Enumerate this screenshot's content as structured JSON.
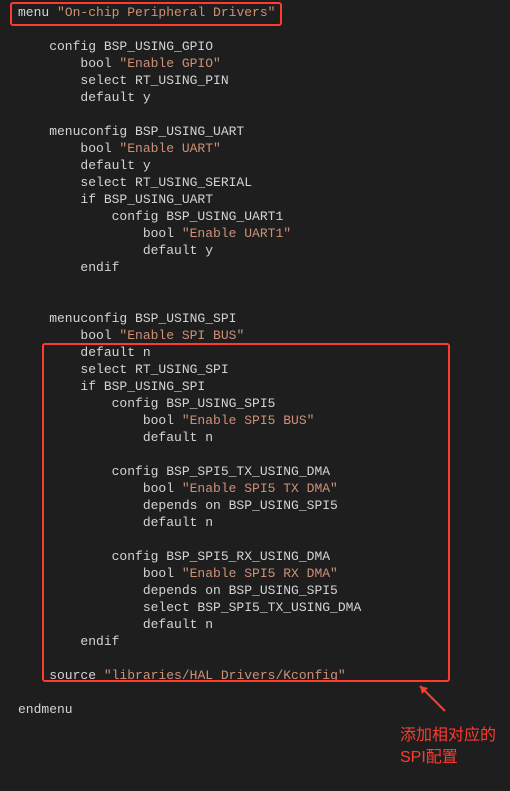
{
  "lines": [
    {
      "indent": 0,
      "t": "menu ",
      "s": "\"On-chip Peripheral Drivers\""
    },
    {
      "blank": true
    },
    {
      "indent": 1,
      "t": "config BSP_USING_GPIO"
    },
    {
      "indent": 2,
      "t": "bool ",
      "s": "\"Enable GPIO\""
    },
    {
      "indent": 2,
      "t": "select RT_USING_PIN"
    },
    {
      "indent": 2,
      "t": "default y"
    },
    {
      "blank": true
    },
    {
      "indent": 1,
      "t": "menuconfig BSP_USING_UART"
    },
    {
      "indent": 2,
      "t": "bool ",
      "s": "\"Enable UART\""
    },
    {
      "indent": 2,
      "t": "default y"
    },
    {
      "indent": 2,
      "t": "select RT_USING_SERIAL"
    },
    {
      "indent": 2,
      "t": "if BSP_USING_UART"
    },
    {
      "indent": 3,
      "t": "config BSP_USING_UART1"
    },
    {
      "indent": 4,
      "t": "bool ",
      "s": "\"Enable UART1\""
    },
    {
      "indent": 4,
      "t": "default y"
    },
    {
      "indent": 2,
      "t": "endif"
    },
    {
      "blank": true
    },
    {
      "blank": true
    },
    {
      "indent": 1,
      "t": "menuconfig BSP_USING_SPI"
    },
    {
      "indent": 2,
      "t": "bool ",
      "s": "\"Enable SPI BUS\""
    },
    {
      "indent": 2,
      "t": "default n"
    },
    {
      "indent": 2,
      "t": "select RT_USING_SPI"
    },
    {
      "indent": 2,
      "t": "if BSP_USING_SPI"
    },
    {
      "indent": 3,
      "t": "config BSP_USING_SPI5"
    },
    {
      "indent": 4,
      "t": "bool ",
      "s": "\"Enable SPI5 BUS\""
    },
    {
      "indent": 4,
      "t": "default n"
    },
    {
      "blank": true
    },
    {
      "indent": 3,
      "t": "config BSP_SPI5_TX_USING_DMA"
    },
    {
      "indent": 4,
      "t": "bool ",
      "s": "\"Enable SPI5 TX DMA\""
    },
    {
      "indent": 4,
      "t": "depends on BSP_USING_SPI5"
    },
    {
      "indent": 4,
      "t": "default n"
    },
    {
      "blank": true
    },
    {
      "indent": 3,
      "t": "config BSP_SPI5_RX_USING_DMA"
    },
    {
      "indent": 4,
      "t": "bool ",
      "s": "\"Enable SPI5 RX DMA\""
    },
    {
      "indent": 4,
      "t": "depends on BSP_USING_SPI5"
    },
    {
      "indent": 4,
      "t": "select BSP_SPI5_TX_USING_DMA"
    },
    {
      "indent": 4,
      "t": "default n"
    },
    {
      "indent": 2,
      "t": "endif"
    },
    {
      "blank": true
    },
    {
      "indent": 1,
      "t": "source ",
      "s": "\"libraries/HAL_Drivers/Kconfig\""
    },
    {
      "blank": true
    },
    {
      "indent": 0,
      "t": "endmenu"
    }
  ],
  "indent_unit": "    ",
  "annotation": "添加相对应的SPI配置"
}
